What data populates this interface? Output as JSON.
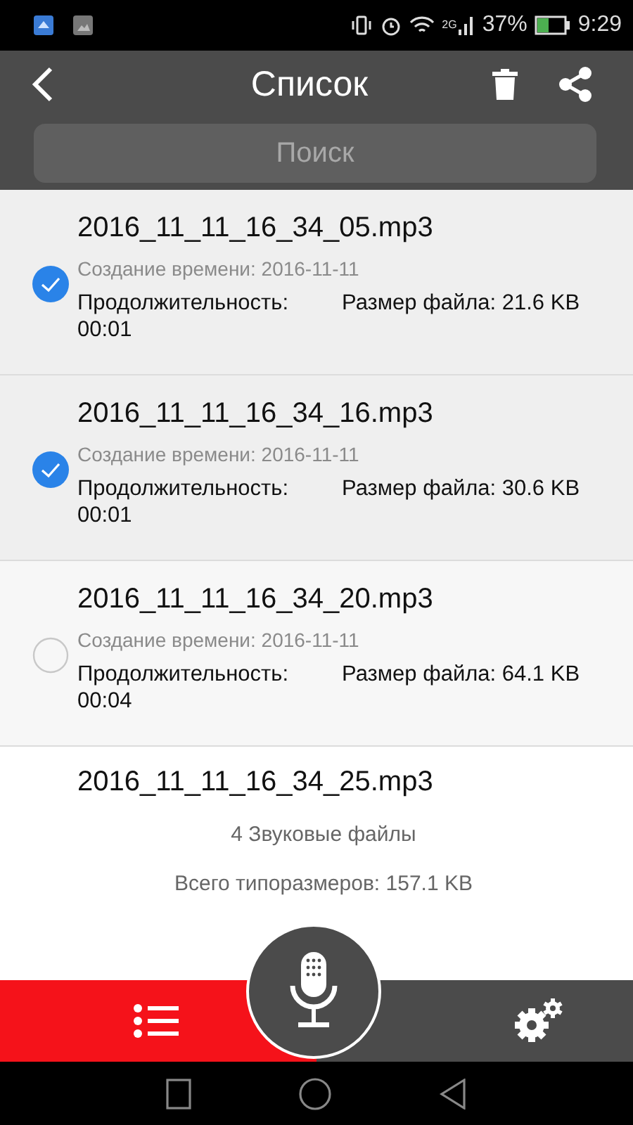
{
  "status_bar": {
    "network": "2G",
    "battery": "37%",
    "time": "9:29"
  },
  "header": {
    "title": "Список"
  },
  "search": {
    "placeholder": "Поиск"
  },
  "files": [
    {
      "kind": "full",
      "name": "2016_11_11_16_34_05.mp3",
      "checked": true,
      "created": "Создание времени: 2016-11-11",
      "duration": "Продолжительность: 00:01",
      "size": "Размер файла: 21.6 KB"
    },
    {
      "kind": "full",
      "name": "2016_11_11_16_34_16.mp3",
      "checked": true,
      "created": "Создание времени: 2016-11-11",
      "duration": "Продолжительность: 00:01",
      "size": "Размер файла: 30.6 KB"
    },
    {
      "kind": "full",
      "name": "2016_11_11_16_34_20.mp3",
      "checked": false,
      "created": "Создание времени: 2016-11-11",
      "duration": "Продолжительность: 00:04",
      "size": "Размер файла: 64.1 KB"
    },
    {
      "kind": "name_only",
      "name": "2016_11_11_16_34_25.mp3"
    }
  ],
  "summary": {
    "count": "4 Звуковые файлы",
    "total": "Всего типоразмеров: 157.1 KB"
  },
  "bottom_tabs": [
    {
      "kind": "list",
      "selected": true
    },
    {
      "kind": "settings",
      "selected": false
    }
  ]
}
